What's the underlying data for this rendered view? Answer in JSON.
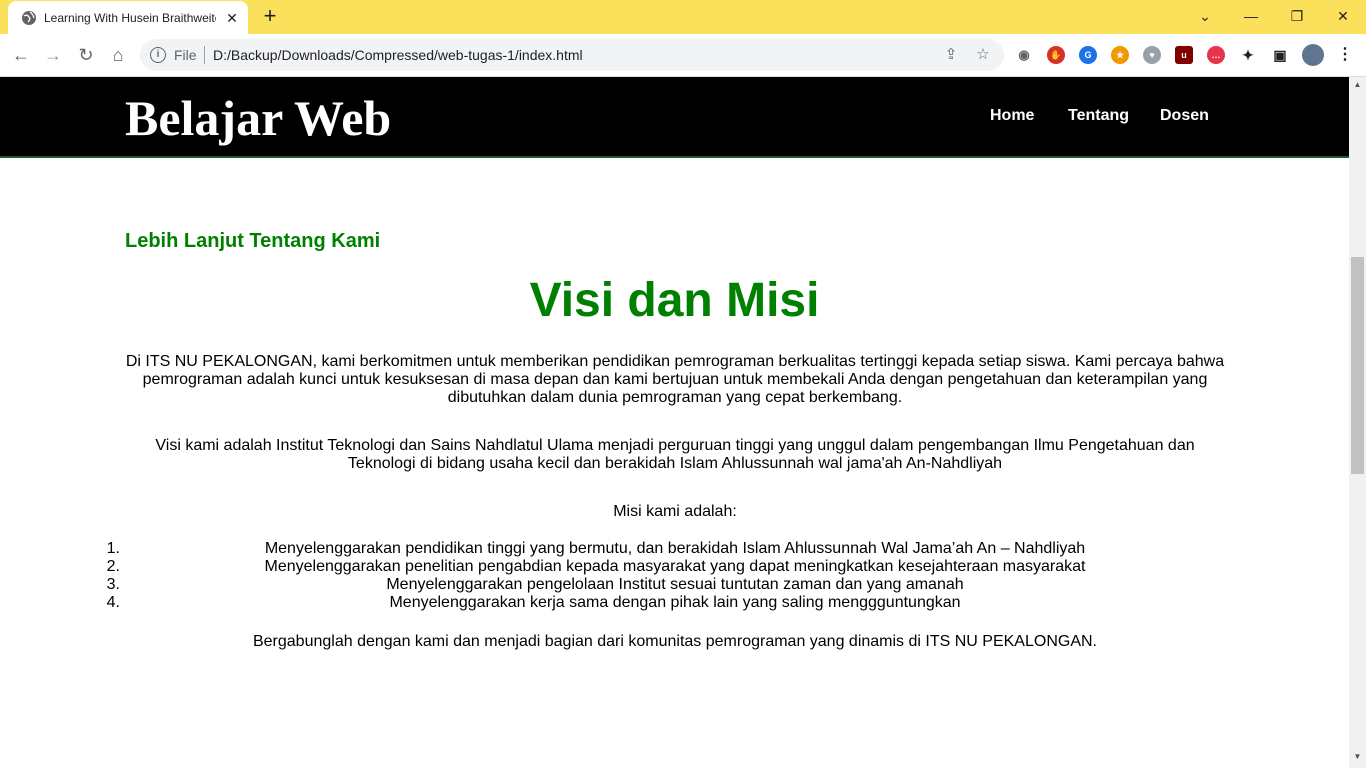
{
  "browser": {
    "tab_title": "Learning With Husein Braithweite",
    "tab_close": "✕",
    "new_tab": "+",
    "omnibox_scheme": "File",
    "url": "D:/Backup/Downloads/Compressed/web-tugas-1/index.html",
    "icons": [
      "back-icon",
      "forward-icon",
      "reload-icon",
      "home-icon",
      "info-icon",
      "share-icon",
      "star-icon",
      "camera-icon",
      "extensions-icon",
      "side-panel-icon",
      "profile-avatar",
      "menu-icon"
    ],
    "window_controls": [
      "minimize",
      "maximize",
      "close"
    ]
  },
  "site": {
    "logo": "Belajar Web",
    "nav": [
      "Home",
      "Tentang",
      "Dosen"
    ]
  },
  "content": {
    "subtitle": "Lebih Lanjut Tentang Kami",
    "title": "Visi dan Misi",
    "intro": "Di ITS NU PEKALONGAN, kami berkomitmen untuk memberikan pendidikan pemrograman berkualitas tertinggi kepada setiap siswa. Kami percaya bahwa pemrograman adalah kunci untuk kesuksesan di masa depan dan kami bertujuan untuk membekali Anda dengan pengetahuan dan keterampilan yang dibutuhkan dalam dunia pemrograman yang cepat berkembang.",
    "visi": "Visi kami adalah Institut Teknologi dan Sains Nahdlatul Ulama menjadi perguruan tinggi yang unggul dalam pengembangan Ilmu Pengetahuan dan Teknologi di bidang usaha kecil dan berakidah Islam Ahlussunnah wal jama'ah An-Nahdliyah",
    "misi_heading": "Misi kami adalah:",
    "misi": [
      {
        "num": "1.",
        "text": "Menyelenggarakan pendidikan tinggi yang bermutu, dan berakidah Islam Ahlussunnah Wal Jama’ah An – Nahdliyah"
      },
      {
        "num": "2.",
        "text": "Menyelenggarakan penelitian pengabdian kepada masyarakat yang dapat meningkatkan kesejahteraan masyarakat"
      },
      {
        "num": "3.",
        "text": "Menyelenggarakan pengelolaan Institut sesuai tuntutan zaman dan yang amanah"
      },
      {
        "num": "4.",
        "text": "Menyelenggarakan kerja sama dengan pihak lain yang saling menggguntungkan"
      }
    ],
    "closing": "Bergabunglah dengan kami dan menjadi bagian dari komunitas pemrograman yang dinamis di ITS NU PEKALONGAN."
  },
  "colors": {
    "tabbar": "#fbe05b",
    "header": "#000000",
    "accent_green": "#008000"
  }
}
